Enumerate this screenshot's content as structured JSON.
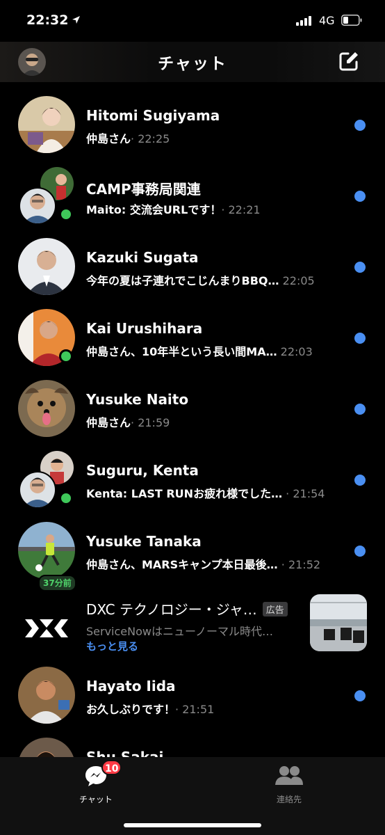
{
  "status": {
    "time": "22:32",
    "network": "4G"
  },
  "header": {
    "title": "チャット"
  },
  "chats": [
    {
      "name": "Hitomi  Sugiyama",
      "preview": "仲島さん",
      "time": "22:25"
    },
    {
      "name": "CAMP事務局関連",
      "preview": "Maito: 交流会URLです！",
      "time": "22:21"
    },
    {
      "name": "Kazuki Sugata",
      "preview": "今年の夏は子連れでこじんまりBBQ…",
      "time": "22:05"
    },
    {
      "name": "Kai Urushihara",
      "preview": "仲島さん、10年半という長い間MA…",
      "time": "22:03"
    },
    {
      "name": "Yusuke  Naito",
      "preview": "仲島さん",
      "time": "21:59"
    },
    {
      "name": "Suguru, Kenta",
      "preview": "Kenta: LAST RUNお疲れ様でした…",
      "time": "21:54"
    },
    {
      "name": "Yusuke Tanaka",
      "preview": "仲島さん、MARSキャンプ本日最後…",
      "time": "21:52",
      "active_badge": "37分前"
    },
    {
      "name": "Hayato Iida",
      "preview": "お久しぶりです！",
      "time": "21:51"
    },
    {
      "name": "Shu Sakai"
    }
  ],
  "ad": {
    "name": "DXC テクノロジー・ジャ…",
    "tag": "広告",
    "text": "ServiceNowはニューノーマル時代…",
    "more": "もっと見る"
  },
  "tabs": {
    "chat": "チャット",
    "contacts": "連絡先",
    "badge": "10"
  },
  "colors": {
    "unread_dot": "#4a8ff2",
    "online": "#3fc85a",
    "badge": "#ff3b45",
    "link": "#4a8ff2"
  }
}
